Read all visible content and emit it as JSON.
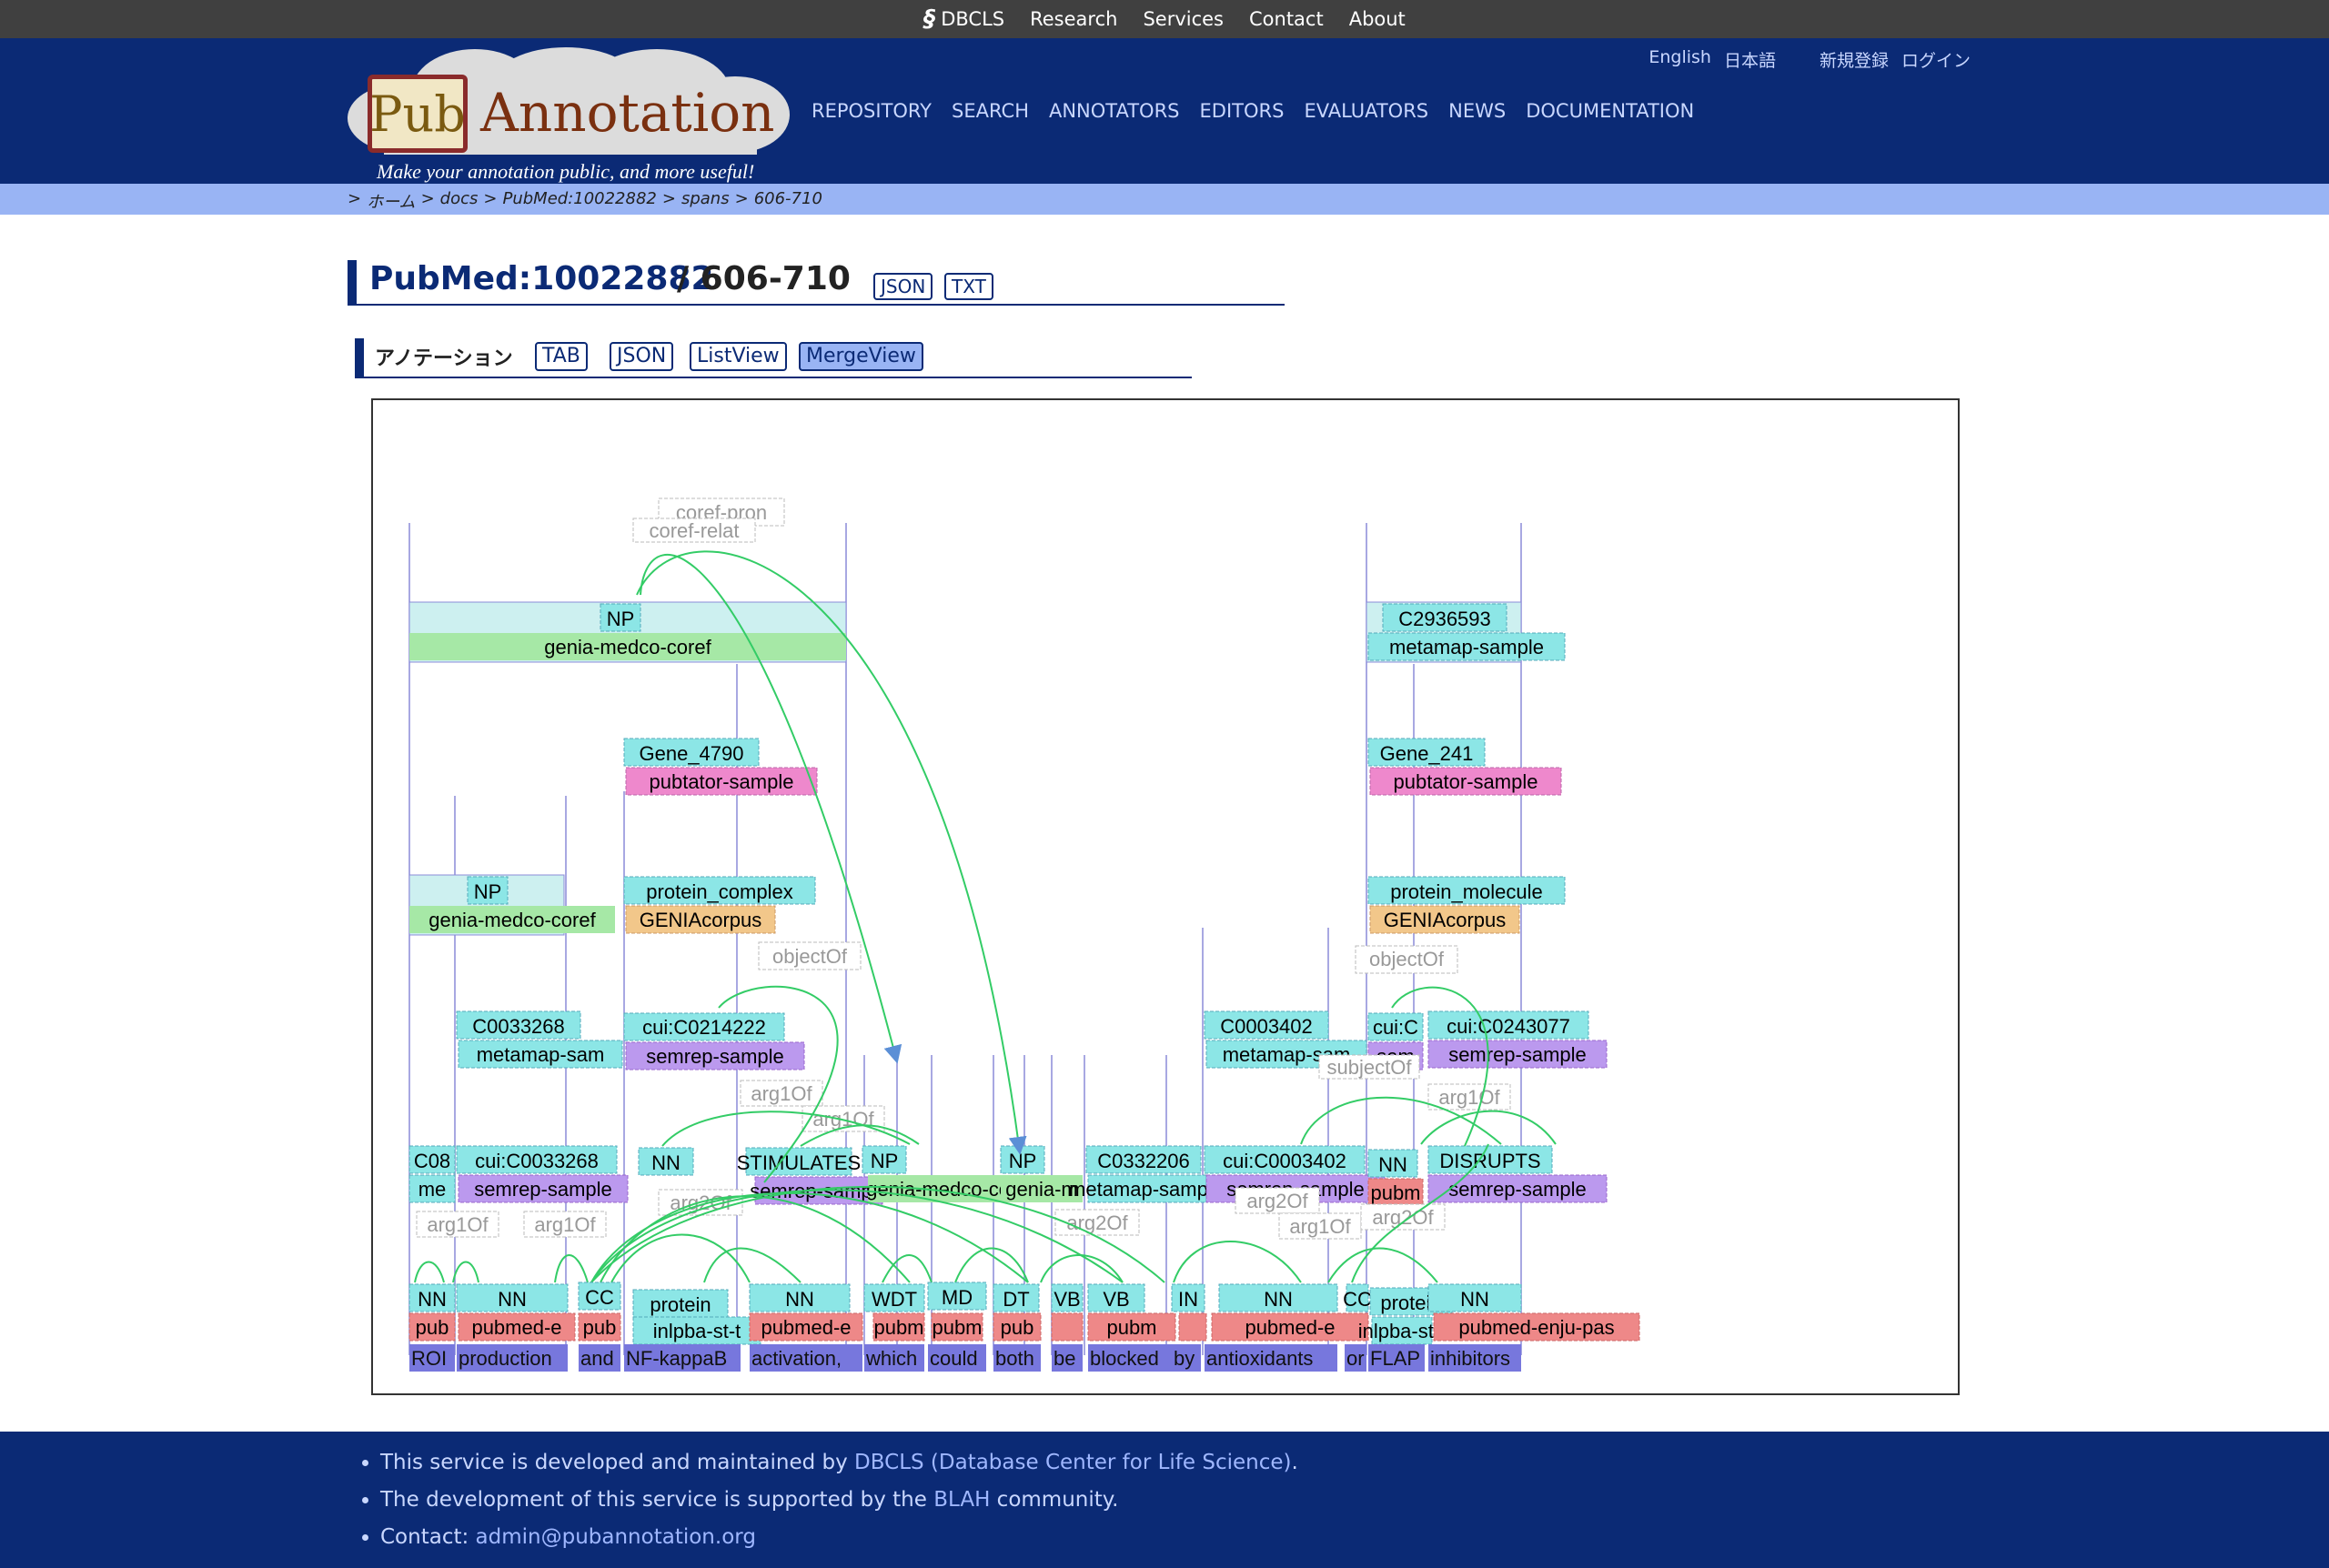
{
  "topbar": {
    "logo_text": "DBCLS",
    "links": [
      "Research",
      "Services",
      "Contact",
      "About"
    ]
  },
  "header": {
    "logo_pub": "Pub",
    "logo_annotation": "Annotation",
    "tagline": "Make your annotation public, and more useful!",
    "nav": [
      "REPOSITORY",
      "SEARCH",
      "ANNOTATORS",
      "EDITORS",
      "EVALUATORS",
      "NEWS",
      "DOCUMENTATION"
    ],
    "lang_nav": [
      "English",
      "日本語",
      "新規登録",
      "ログイン"
    ]
  },
  "breadcrumb": [
    ">",
    "ホーム",
    ">",
    "docs",
    ">",
    "PubMed:10022882",
    ">",
    "spans",
    ">",
    "606-710"
  ],
  "page": {
    "title_doc": "PubMed:10022882",
    "title_span": "/ 606-710",
    "formats": [
      "JSON",
      "TXT"
    ]
  },
  "annotations": {
    "label": "アノテーション",
    "views": [
      "TAB",
      "JSON",
      "ListView",
      "MergeView"
    ],
    "active_view": "MergeView"
  },
  "viewer": {
    "words": [
      "ROI",
      "production",
      "and",
      "NF-kappaB",
      "activation,",
      "which",
      "could",
      "both",
      "be",
      "blocked",
      "by",
      "antioxidants",
      "or",
      "FLAP",
      "inhibitors"
    ],
    "text_color": "#7777dd",
    "labels": {
      "coref_pron": "coref-pron",
      "coref_relat": "coref-relat",
      "np": "NP",
      "genia_medco_coref": "genia-medco-coref",
      "c2936593": "C2936593",
      "metamap_sample": "metamap-sample",
      "gene_4790": "Gene_4790",
      "gene_241": "Gene_241",
      "pubtator_sample": "pubtator-sample",
      "protein_complex": "protein_complex",
      "protein_molecule": "protein_molecule",
      "geniacorpus": "GENIAcorpus",
      "object_of": "objectOf",
      "subject_of": "subjectOf",
      "arg1of": "arg1Of",
      "arg2of": "arg2Of",
      "c0033268": "C0033268",
      "metamap_sam": "metamap-sam",
      "cui_c0214222": "cui:C0214222",
      "semrep_sample": "semrep-sample",
      "c0003402": "C0003402",
      "cui_c0243077": "cui:C0243077",
      "cui_c0033268": "cui:C0033268",
      "c0332206": "C0332206",
      "cui_c0003402": "cui:C0003402",
      "disrupts": "DISRUPTS",
      "stimulate": "STIMULATES",
      "nn": "NN",
      "cc": "CC",
      "wdt": "WDT",
      "md": "MD",
      "dt": "DT",
      "vb": "VB",
      "in": "IN",
      "protein": "protein",
      "inlpba": "inlpba-st-t",
      "pubmed_enju": "pubmed-enju-pas",
      "pubmed_e": "pubmed-e",
      "pubm": "pubm",
      "pub": "pub",
      "c08": "C08",
      "me": "me",
      "cui_c": "cui:C",
      "sem": "sem",
      "genia_m": "genia-m"
    },
    "colors": {
      "type_fill": "#8ce6e6",
      "genia_fill": "#a6e8a6",
      "pubtator_fill": "#ee88cc",
      "genia_corpus_fill": "#f2c78a",
      "semrep_fill": "#bb99ee",
      "pubmed_fill": "#ee8888",
      "arc": "#33cc66",
      "span_box": "#cdf0f0"
    }
  },
  "footer": {
    "line1_pre": "This service is developed and maintained by ",
    "line1_link": "DBCLS (Database Center for Life Science)",
    "line1_post": ".",
    "line2_pre": "The development of this service is supported by the ",
    "line2_link": "BLAH",
    "line2_post": " community.",
    "line3_pre": "Contact: ",
    "line3_link": "admin@pubannotation.org"
  }
}
